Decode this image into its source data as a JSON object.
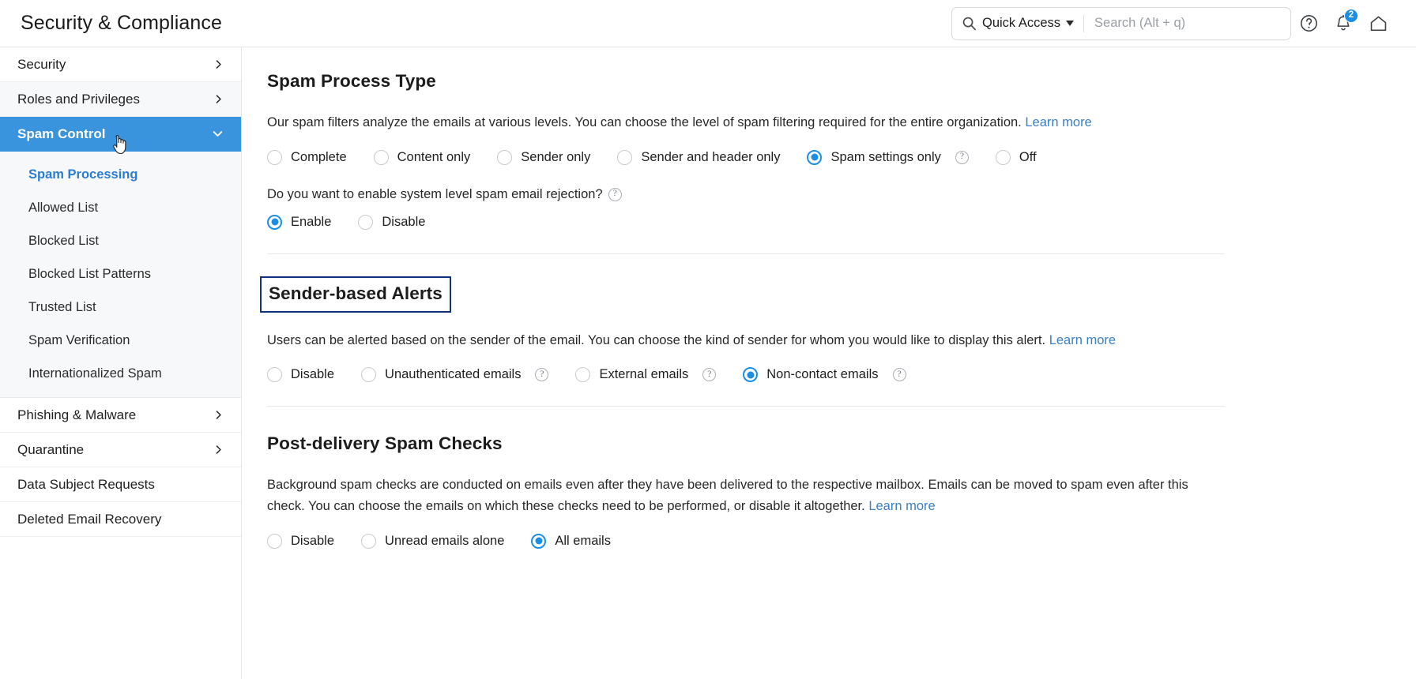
{
  "header": {
    "title": "Security & Compliance",
    "search": {
      "quick_access_label": "Quick Access",
      "placeholder": "Search (Alt + q)"
    },
    "icons": {
      "search": "search-icon",
      "help": "help-circle-icon",
      "notifications": "bell-icon",
      "home": "home-icon"
    },
    "notification_count": "2"
  },
  "sidebar": {
    "items": [
      {
        "label": "Security",
        "has_chevron": true,
        "state": "collapsed"
      },
      {
        "label": "Roles and Privileges",
        "has_chevron": true,
        "state": "collapsed"
      },
      {
        "label": "Spam Control",
        "has_chevron": true,
        "state": "expanded"
      },
      {
        "label": "Phishing & Malware",
        "has_chevron": true,
        "state": "collapsed"
      },
      {
        "label": "Quarantine",
        "has_chevron": true,
        "state": "collapsed"
      },
      {
        "label": "Data Subject Requests",
        "has_chevron": false,
        "state": "none"
      },
      {
        "label": "Deleted Email Recovery",
        "has_chevron": false,
        "state": "none"
      }
    ],
    "spam_control_children": [
      {
        "label": "Spam Processing",
        "selected": true
      },
      {
        "label": "Allowed List",
        "selected": false
      },
      {
        "label": "Blocked List",
        "selected": false
      },
      {
        "label": "Blocked List Patterns",
        "selected": false
      },
      {
        "label": "Trusted List",
        "selected": false
      },
      {
        "label": "Spam Verification",
        "selected": false
      },
      {
        "label": "Internationalized Spam",
        "selected": false
      }
    ]
  },
  "main": {
    "spam_process_type": {
      "title": "Spam Process Type",
      "description": "Our spam filters analyze the emails at various levels. You can choose the level of spam filtering required for the entire organization.",
      "learn_more": "Learn more",
      "options": [
        {
          "label": "Complete",
          "selected": false,
          "help": false
        },
        {
          "label": "Content only",
          "selected": false,
          "help": false
        },
        {
          "label": "Sender only",
          "selected": false,
          "help": false
        },
        {
          "label": "Sender and header only",
          "selected": false,
          "help": false
        },
        {
          "label": "Spam settings only",
          "selected": true,
          "help": true
        },
        {
          "label": "Off",
          "selected": false,
          "help": false
        }
      ],
      "rejection_question": "Do you want to enable system level spam email rejection?",
      "rejection_options": [
        {
          "label": "Enable",
          "selected": true,
          "help": false
        },
        {
          "label": "Disable",
          "selected": false,
          "help": false
        }
      ]
    },
    "sender_based_alerts": {
      "title": "Sender-based Alerts",
      "description": "Users can be alerted based on the sender of the email. You can choose the kind of sender for whom you would like to display this alert.",
      "learn_more": "Learn more",
      "options": [
        {
          "label": "Disable",
          "selected": false,
          "help": false
        },
        {
          "label": "Unauthenticated emails",
          "selected": false,
          "help": true
        },
        {
          "label": "External emails",
          "selected": false,
          "help": true
        },
        {
          "label": "Non-contact emails",
          "selected": true,
          "help": true
        }
      ]
    },
    "post_delivery_spam_checks": {
      "title": "Post-delivery Spam Checks",
      "description": "Background spam checks are conducted on emails even after they have been delivered to the respective mailbox. Emails can be moved to spam even after this check. You can choose the emails on which these checks need to be performed, or disable it altogether.",
      "learn_more": "Learn more",
      "options": [
        {
          "label": "Disable",
          "selected": false,
          "help": false
        },
        {
          "label": "Unread emails alone",
          "selected": false,
          "help": false
        },
        {
          "label": "All emails",
          "selected": true,
          "help": false
        }
      ]
    }
  },
  "colors": {
    "accent": "#1a8fe3",
    "sidebar_active": "#3a93dd",
    "link": "#3b7fc4",
    "focus_outline": "#11307e"
  }
}
